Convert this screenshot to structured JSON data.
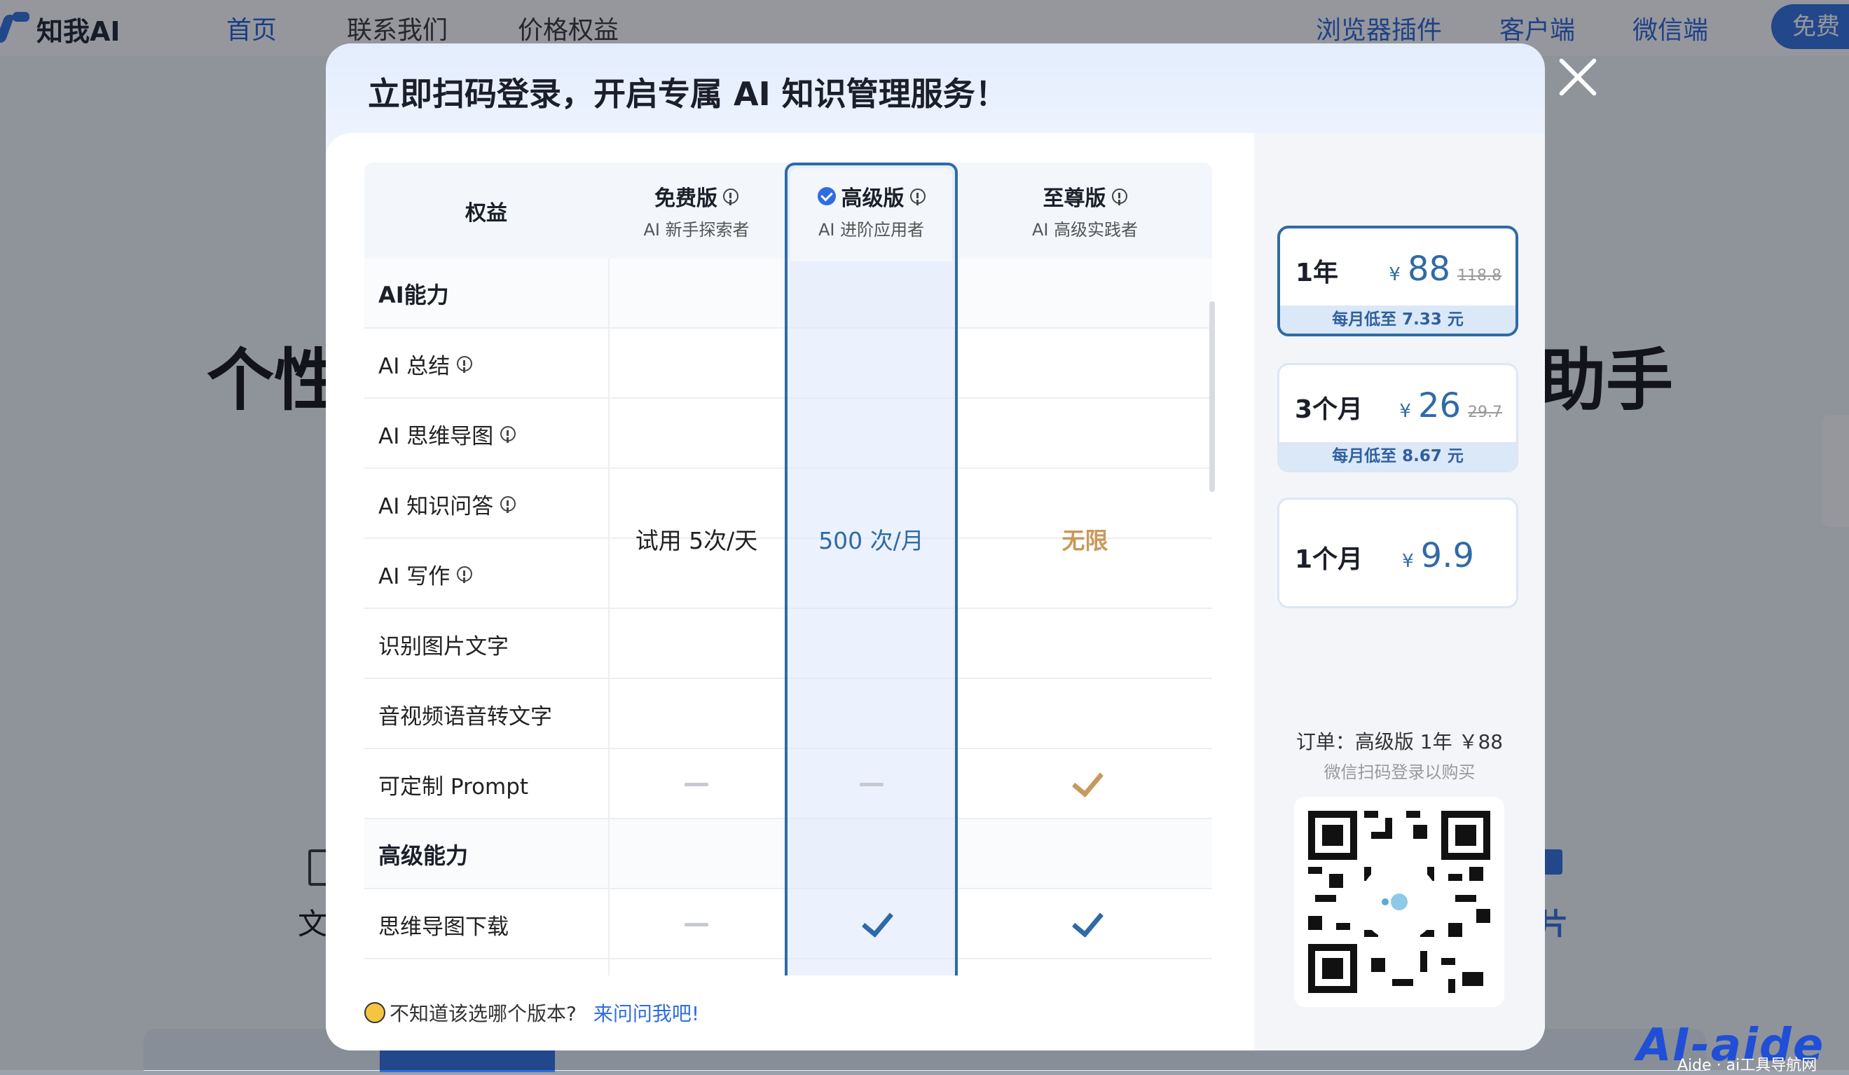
{
  "nav": {
    "logo_text": "知我AI",
    "items": [
      "首页",
      "联系我们",
      "价格权益"
    ],
    "right_items": [
      "浏览器插件",
      "客户端",
      "微信端"
    ],
    "free_button": "免费"
  },
  "background": {
    "hero_left": "个性",
    "hero_right": "助手",
    "feature_left": "文",
    "feature_right": "片",
    "watermark": "AI-aide",
    "watermark_sub": "Aide · ai工具导航网"
  },
  "modal": {
    "title": "立即扫码登录，开启专属 AI 知识管理服务！",
    "table": {
      "header_label": "权益",
      "tiers": [
        {
          "name": "免费版",
          "subtitle": "AI 新手探索者"
        },
        {
          "name": "高级版",
          "subtitle": "AI 进阶应用者"
        },
        {
          "name": "至尊版",
          "subtitle": "AI 高级实践者"
        }
      ],
      "section_ai": "AI能力",
      "ai_rows": [
        "AI 总结",
        "AI 思维导图",
        "AI 知识问答",
        "AI 写作",
        "识别图片文字",
        "音视频语音转文字"
      ],
      "ai_quota": {
        "free": "试用 5次/天",
        "premium": "500 次/月",
        "ultimate": "无限"
      },
      "prompt_row": "可定制 Prompt",
      "section_advanced": "高级能力",
      "mindmap_row": "思维导图下载"
    },
    "help_text": "不知道该选哪个版本?",
    "help_link": "来问问我吧!",
    "plans": [
      {
        "duration": "1年",
        "currency": "¥",
        "price": "88",
        "original": "118.8",
        "monthly": "每月低至 7.33 元",
        "selected": true
      },
      {
        "duration": "3个月",
        "currency": "¥",
        "price": "26",
        "original": "29.7",
        "monthly": "每月低至 8.67 元",
        "selected": false
      },
      {
        "duration": "1个月",
        "currency": "¥",
        "price": "9.9",
        "original": "",
        "monthly": "",
        "selected": false
      }
    ],
    "order_text": "订单：高级版 1年 ￥88",
    "order_hint": "微信扫码登录以购买"
  },
  "colors": {
    "accent": "#2f6de1",
    "highlight_border": "#2f6aa7",
    "gold": "#c8995a"
  }
}
